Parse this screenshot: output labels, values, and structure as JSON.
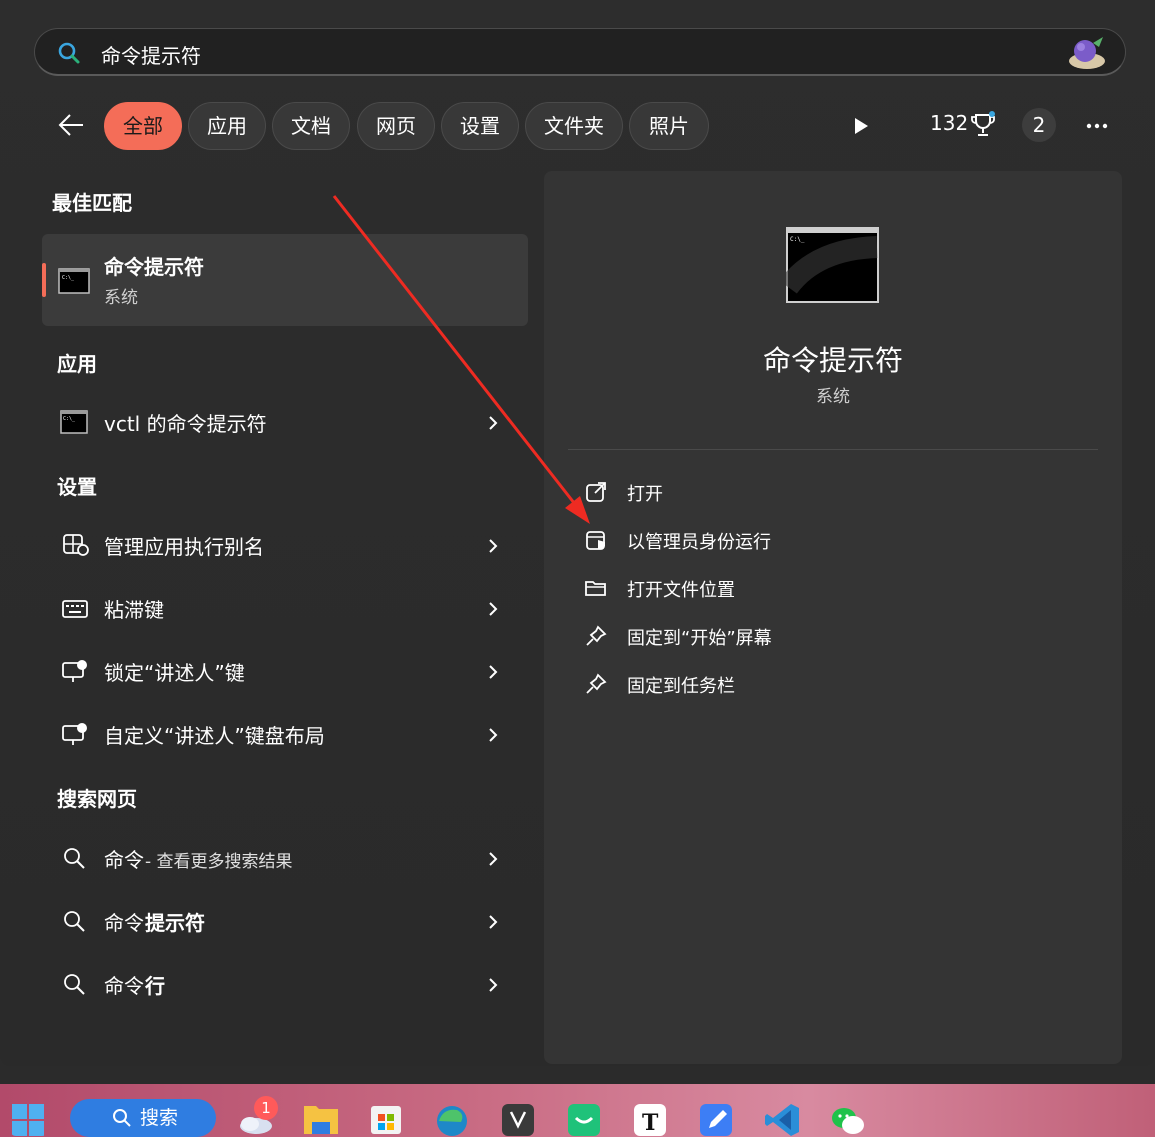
{
  "search": {
    "query": "命令提示符"
  },
  "filters": [
    {
      "label": "全部",
      "active": true
    },
    {
      "label": "应用",
      "active": false
    },
    {
      "label": "文档",
      "active": false
    },
    {
      "label": "网页",
      "active": false
    },
    {
      "label": "设置",
      "active": false
    },
    {
      "label": "文件夹",
      "active": false
    },
    {
      "label": "照片",
      "active": false
    }
  ],
  "toolbar": {
    "points": "132",
    "badge": "2"
  },
  "sections": {
    "best": "最佳匹配",
    "apps": "应用",
    "settings": "设置",
    "web": "搜索网页"
  },
  "best_match": {
    "title": "命令提示符",
    "subtitle": "系统"
  },
  "apps": [
    {
      "title": "vctl 的命令提示符"
    }
  ],
  "settings": [
    {
      "title": "管理应用执行别名",
      "icon": "app-alias-icon"
    },
    {
      "title": "粘滞键",
      "icon": "keyboard-icon"
    },
    {
      "title": "锁定“讲述人”键",
      "icon": "narrator-icon"
    },
    {
      "title": "自定义“讲述人”键盘布局",
      "icon": "narrator-icon"
    }
  ],
  "web": [
    {
      "prefix": "命令",
      "suffix": " - 查看更多搜索结果"
    },
    {
      "prefix": "命令",
      "suffix": "提示符"
    },
    {
      "prefix": "命令",
      "suffix": "行"
    }
  ],
  "preview": {
    "title": "命令提示符",
    "subtitle": "系统",
    "actions": [
      {
        "label": "打开",
        "icon": "open-external-icon"
      },
      {
        "label": "以管理员身份运行",
        "icon": "admin-shield-icon"
      },
      {
        "label": "打开文件位置",
        "icon": "folder-icon"
      },
      {
        "label": "固定到“开始”屏幕",
        "icon": "pin-icon"
      },
      {
        "label": "固定到任务栏",
        "icon": "pin-icon"
      }
    ]
  },
  "taskbar": {
    "search_label": "搜索",
    "weather_badge": "1"
  },
  "colors": {
    "accent": "#f46d58",
    "panel": "#2b2b2b",
    "annotation": "#ee2b22"
  }
}
